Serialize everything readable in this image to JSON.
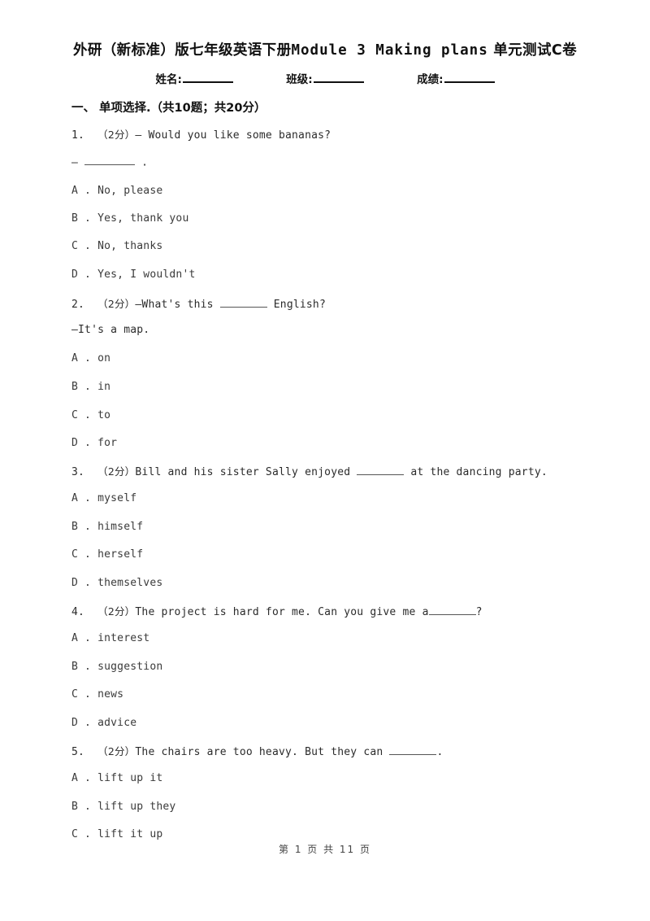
{
  "document": {
    "title_prefix_zh": "外研（新标准）版七年级英语下册",
    "title_latin": "Module 3 Making plans",
    "title_suffix_zh": "单元测试C卷",
    "title_full": "外研（新标准）版七年级英语下册 Module 3 Making plans 单元测试C卷"
  },
  "meta": {
    "name_label": "姓名:",
    "class_label": "班级:",
    "score_label": "成绩:"
  },
  "section": {
    "heading": "一、 单项选择.（共10题；共20分）"
  },
  "questions": [
    {
      "number": "1.",
      "marks": "（2分）",
      "stem": "— Would you like some bananas?",
      "stem_line2_prefix": "— ",
      "stem_line2_suffix": " .",
      "options": [
        "A . No, please",
        "B . Yes, thank you",
        "C . No, thanks",
        "D . Yes, I wouldn't"
      ]
    },
    {
      "number": "2.",
      "marks": "（2分）",
      "stem_prefix": "—What's this ",
      "stem_suffix": " English?",
      "stem_line2": "—It's a map.",
      "options": [
        "A . on",
        "B . in",
        "C . to",
        "D . for"
      ]
    },
    {
      "number": "3.",
      "marks": "（2分）",
      "stem_prefix": "Bill and his sister Sally enjoyed ",
      "stem_suffix": " at the dancing party.",
      "options": [
        "A . myself",
        "B . himself",
        "C . herself",
        "D . themselves"
      ]
    },
    {
      "number": "4.",
      "marks": "（2分）",
      "stem_prefix": "The project is hard for me. Can you give me a",
      "stem_suffix": "?",
      "options": [
        "A . interest",
        "B . suggestion",
        "C . news",
        "D . advice"
      ]
    },
    {
      "number": "5.",
      "marks": "（2分）",
      "stem_prefix": "The chairs are too heavy. But they can ",
      "stem_suffix": ".",
      "options": [
        "A . lift up it",
        "B . lift up they",
        "C . lift it up"
      ]
    }
  ],
  "footer": {
    "text": "第 1 页 共 11 页"
  }
}
